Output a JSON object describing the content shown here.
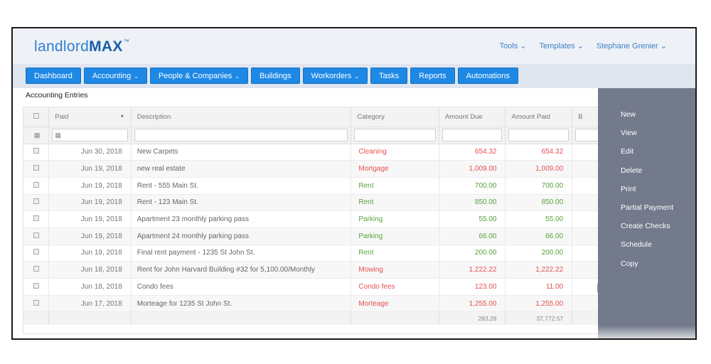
{
  "app": {
    "logo_text_light": "landlord",
    "logo_text_bold": "MAX",
    "logo_tm": "™"
  },
  "top_links": [
    {
      "label": "Tools ⌄"
    },
    {
      "label": "Templates ⌄"
    },
    {
      "label": "Stephane Grenier ⌄"
    }
  ],
  "nav": [
    {
      "label": "Dashboard",
      "dropdown": false
    },
    {
      "label": "Accounting",
      "dropdown": true
    },
    {
      "label": "People & Companies",
      "dropdown": true
    },
    {
      "label": "Buildings",
      "dropdown": false
    },
    {
      "label": "Workorders",
      "dropdown": true
    },
    {
      "label": "Tasks",
      "dropdown": false
    },
    {
      "label": "Reports",
      "dropdown": false
    },
    {
      "label": "Automations",
      "dropdown": false
    }
  ],
  "nav_caret": "⌄",
  "section_title": "Accounting Entries",
  "columns": {
    "paid": "Paid",
    "paid_sort": "▾",
    "description": "Description",
    "category": "Category",
    "amount_due": "Amount Due",
    "amount_paid": "Amount Paid",
    "extra": "B"
  },
  "icons": {
    "calendar": "▦",
    "checkbox": "checkbox"
  },
  "colors": {
    "nav_button": "#1e88e5",
    "red": "#e65050",
    "green": "#58a33b",
    "sidebar": "#737a8c"
  },
  "rows": [
    {
      "date": "Jun 30, 2018",
      "description": "New Carpets",
      "category": "Cleaning",
      "amount_due": "654.32",
      "amount_paid": "654.32",
      "status": "red"
    },
    {
      "date": "Jun 19, 2018",
      "description": "new real estate",
      "category": "Mortgage",
      "amount_due": "1,009.00",
      "amount_paid": "1,009.00",
      "status": "red"
    },
    {
      "date": "Jun 19, 2018",
      "description": "Rent - 555 Main St.",
      "category": "Rent",
      "amount_due": "700.00",
      "amount_paid": "700.00",
      "status": "green"
    },
    {
      "date": "Jun 19, 2018",
      "description": "Rent - 123 Main St.",
      "category": "Rent",
      "amount_due": "850.00",
      "amount_paid": "850.00",
      "status": "green"
    },
    {
      "date": "Jun 19, 2018",
      "description": "Apartment 23 monthly parking pass",
      "category": "Parking",
      "amount_due": "55.00",
      "amount_paid": "55.00",
      "status": "green"
    },
    {
      "date": "Jun 19, 2018",
      "description": "Apartment 24 monthly parking pass",
      "category": "Parking",
      "amount_due": "66.00",
      "amount_paid": "66.00",
      "status": "green"
    },
    {
      "date": "Jun 19, 2018",
      "description": "Final rent payment - 1235 St John St.",
      "category": "Rent",
      "amount_due": "200.00",
      "amount_paid": "200.00",
      "status": "green"
    },
    {
      "date": "Jun 18, 2018",
      "description": "Rent for John Harvard Building #32 for 5,100.00/Monthly",
      "category": "Mowing",
      "amount_due": "1,222.22",
      "amount_paid": "1,222.22",
      "status": "red"
    },
    {
      "date": "Jun 18, 2018",
      "description": "Condo fees",
      "category": "Condo fees",
      "amount_due": "123.00",
      "amount_paid": "11.00",
      "status": "red"
    },
    {
      "date": "Jun 17, 2018",
      "description": "Morteage for 1235 St John St.",
      "category": "Morteage",
      "amount_due": "1,255.00",
      "amount_paid": "1,255.00",
      "status": "red"
    }
  ],
  "totals": {
    "amount_due": "283.28",
    "amount_paid": "37,772.57"
  },
  "actions": [
    {
      "label": "New"
    },
    {
      "label": "View"
    },
    {
      "label": "Edit"
    },
    {
      "label": "Delete"
    },
    {
      "label": "Print"
    },
    {
      "label": "Partial Payment"
    },
    {
      "label": "Create Checks"
    },
    {
      "label": "Schedule"
    },
    {
      "label": "Copy"
    }
  ]
}
